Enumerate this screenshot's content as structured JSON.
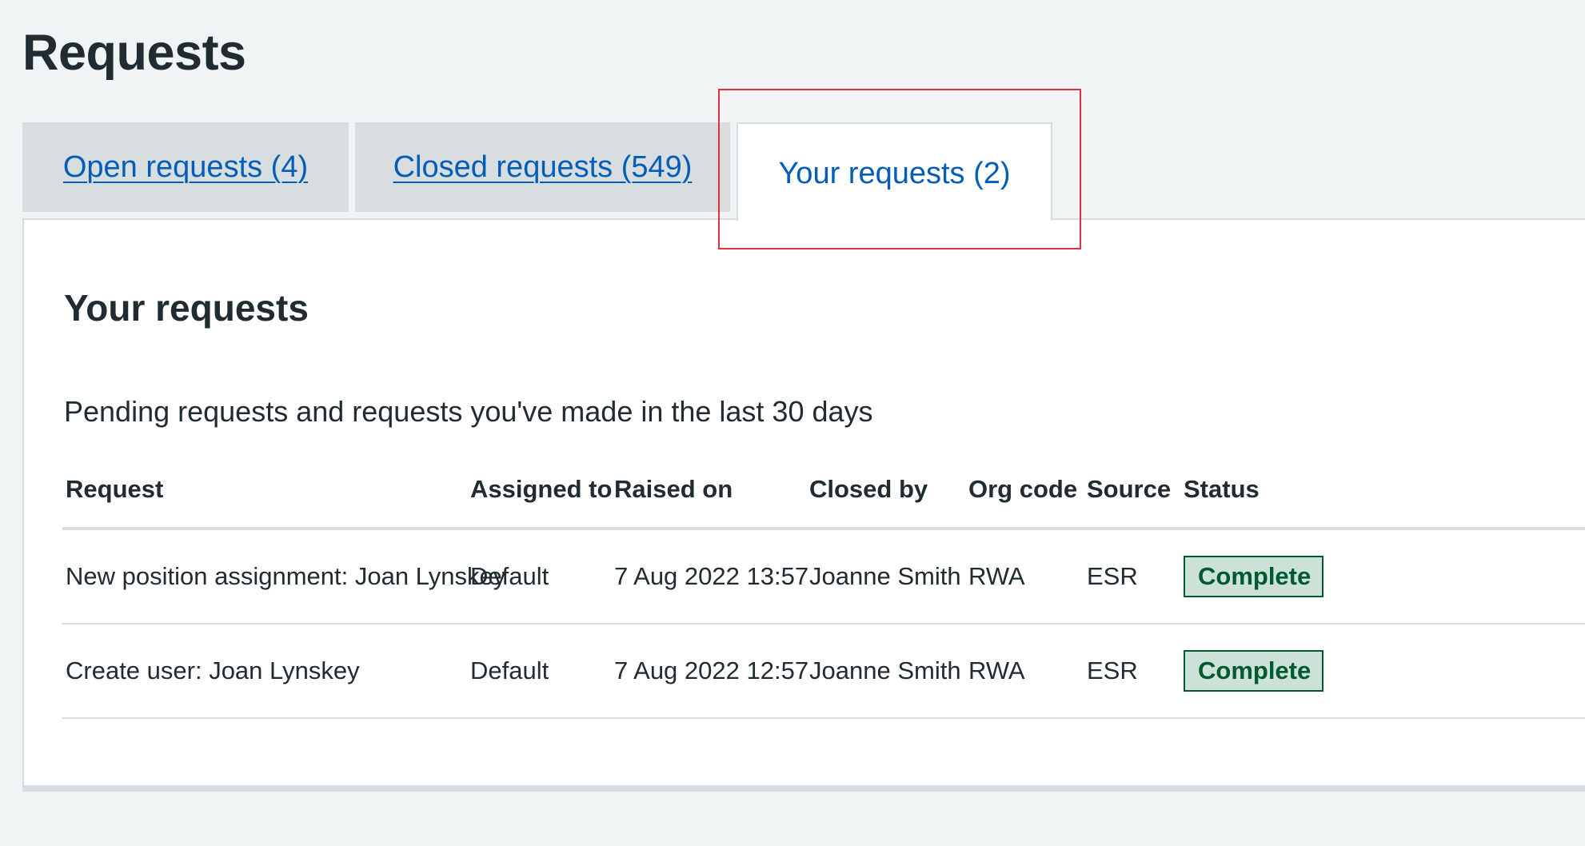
{
  "page": {
    "title": "Requests"
  },
  "tabs": [
    {
      "label": "Open requests (4)",
      "active": false
    },
    {
      "label": "Closed requests (549)",
      "active": false
    },
    {
      "label": "Your requests (2)",
      "active": true
    }
  ],
  "panel": {
    "title": "Your requests",
    "description": "Pending requests and requests you've made in the last 30 days"
  },
  "table": {
    "columns": [
      "Request",
      "Assigned to",
      "Raised on",
      "Closed by",
      "Org code",
      "Source",
      "Status"
    ],
    "rows": [
      {
        "request": "New position assignment: Joan Lynskey",
        "assigned_to": "Default",
        "raised_on": "7 Aug 2022 13:57",
        "closed_by": "Joanne Smith",
        "org_code": "RWA",
        "source": "ESR",
        "status": "Complete"
      },
      {
        "request": "Create user: Joan Lynskey",
        "assigned_to": "Default",
        "raised_on": "7 Aug 2022 12:57",
        "closed_by": "Joanne Smith",
        "org_code": "RWA",
        "source": "ESR",
        "status": "Complete"
      }
    ]
  },
  "colors": {
    "background": "#f0f4f5",
    "link": "#005eb8",
    "text": "#212b32",
    "tab_inactive": "#d8dde0",
    "highlight": "#e5303c",
    "status_complete_bg": "#cce2d8",
    "status_complete_text": "#005a30"
  }
}
